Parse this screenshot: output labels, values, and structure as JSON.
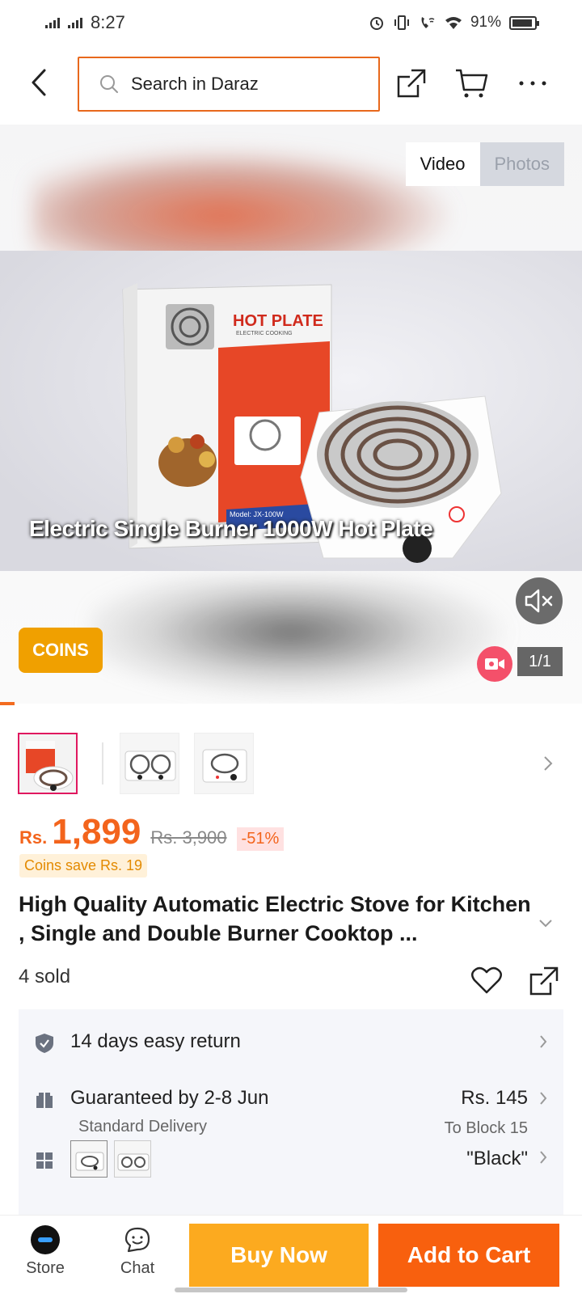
{
  "status_bar": {
    "time": "8:27",
    "battery": "91%",
    "battery_level": 0.91
  },
  "header": {
    "search_placeholder": "Search in Daraz",
    "icons": [
      "back-arrow-icon",
      "share-icon",
      "cart-icon",
      "more-icon"
    ]
  },
  "media": {
    "tabs": [
      {
        "label": "Video",
        "active": true
      },
      {
        "label": "Photos",
        "active": false
      }
    ],
    "caption": "Electric Single Burner 1000W Hot Plate",
    "box_brand": "HOT PLATE",
    "box_sub": "ELECTRIC COOKING",
    "box_model": "Model: JX-100W",
    "coins_badge": "COINS",
    "counter": "1/1",
    "progress": 0.025
  },
  "thumbnails": [
    {
      "name": "single-burner-box",
      "selected": true
    },
    {
      "name": "double-burner",
      "selected": false
    },
    {
      "name": "single-burner",
      "selected": false
    }
  ],
  "price": {
    "currency": "Rs.",
    "current": "1,899",
    "original": "Rs. 3,900",
    "discount": "-51%",
    "coins_save": "Coins save Rs. 19"
  },
  "product": {
    "title": "High Quality Automatic Electric Stove for Kitchen , Single and Double Burner Cooktop ...",
    "sold": "4 sold"
  },
  "info": {
    "return": "14 days easy return",
    "delivery_guarantee": "Guaranteed by 2-8 Jun",
    "delivery_type": "Standard Delivery",
    "delivery_fee": "Rs. 145",
    "delivery_destination": "To Block 15",
    "variant": "\"Black\""
  },
  "bottom_bar": {
    "store_label": "Store",
    "chat_label": "Chat",
    "buy_now": "Buy Now",
    "add_to_cart": "Add to Cart"
  },
  "colors": {
    "accent": "#f8600e",
    "buy_now": "#fcaa1f",
    "price": "#f3641c",
    "coins": "#f0a000"
  }
}
